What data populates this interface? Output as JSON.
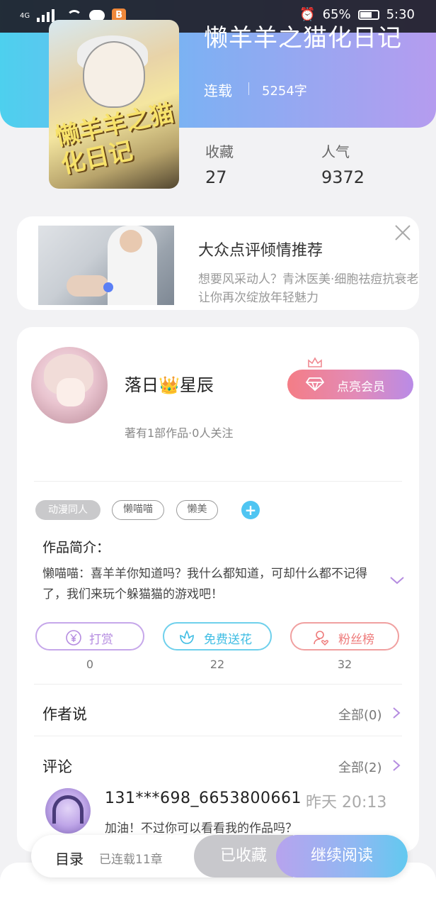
{
  "status_bar": {
    "network": "4G",
    "battery": "65%",
    "time": "5:30",
    "app_icon": "B"
  },
  "book": {
    "title": "懒羊羊之猫化日记",
    "cover_text": "懒羊羊之猫化日记",
    "status": "连载",
    "word_count": "5254字",
    "favorites_label": "收藏",
    "favorites_value": "27",
    "popularity_label": "人气",
    "popularity_value": "9372"
  },
  "ad": {
    "title": "大众点评倾情推荐",
    "description": "想要风采动人？青沐医美·细胞祛痘抗衰老让你再次绽放年轻魅力"
  },
  "author": {
    "name_part1": "落日",
    "crown_emoji": "👑",
    "name_part2": "星辰",
    "stats": "著有1部作品·0人关注",
    "vip_button": "点亮会员"
  },
  "tags": [
    "动漫同人",
    "懒喵喵",
    "懒美"
  ],
  "intro": {
    "title": "作品简介：",
    "text": "懒喵喵：喜羊羊你知道吗？我什么都知道，可却什么都不记得了，我们来玩个躲猫猫的游戏吧！"
  },
  "actions": [
    {
      "label": "打赏",
      "count": "0",
      "color": "#b58ce0",
      "icon": "yen-icon"
    },
    {
      "label": "免费送花",
      "count": "22",
      "color": "#45c3e6",
      "icon": "flower-icon"
    },
    {
      "label": "粉丝榜",
      "count": "32",
      "color": "#ee7a7a",
      "icon": "fans-icon"
    }
  ],
  "author_says": {
    "title": "作者说",
    "more": "全部(0)"
  },
  "comments": {
    "title": "评论",
    "more": "全部(2)",
    "items": [
      {
        "user": "131***698_6653800661",
        "time": "昨天 20:13",
        "text": "加油！不过你可以看看我的作品吗？"
      }
    ]
  },
  "bottom_bar": {
    "toc_label": "目录",
    "toc_sub": "已连载11章",
    "collected_label": "已收藏",
    "read_label": "继续阅读"
  },
  "colors": {
    "hero_gradient_start": "#4dd0ee",
    "hero_gradient_end": "#b59cef",
    "accent_purple": "#b58ce0"
  }
}
